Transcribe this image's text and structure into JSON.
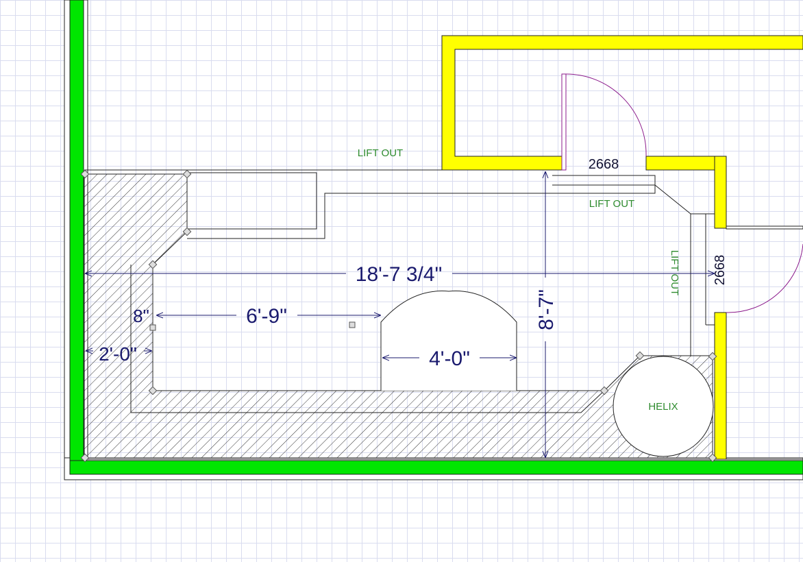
{
  "colors": {
    "grid": "#d9dcef",
    "exterior_wall": "#00e600",
    "interior_wall": "#ffff00",
    "dimension_text": "#1a1a6e",
    "note_text": "#2e8b2e",
    "door_swing": "#8b1a8b"
  },
  "dimensions": {
    "overall_length": "18'-7 3/4\"",
    "overall_depth": "8'-7\"",
    "aisle_length": "6'-9\"",
    "peninsula_width": "4'-0\"",
    "shelf_depth": "2'-0\"",
    "offset": "8\""
  },
  "doors": {
    "north": "2668",
    "east": "2668"
  },
  "notes": {
    "lift_out_top": "LIFT OUT",
    "lift_out_mid": "LIFT OUT",
    "lift_out_vertical": "LIFT OUT",
    "helix": "HELIX"
  }
}
